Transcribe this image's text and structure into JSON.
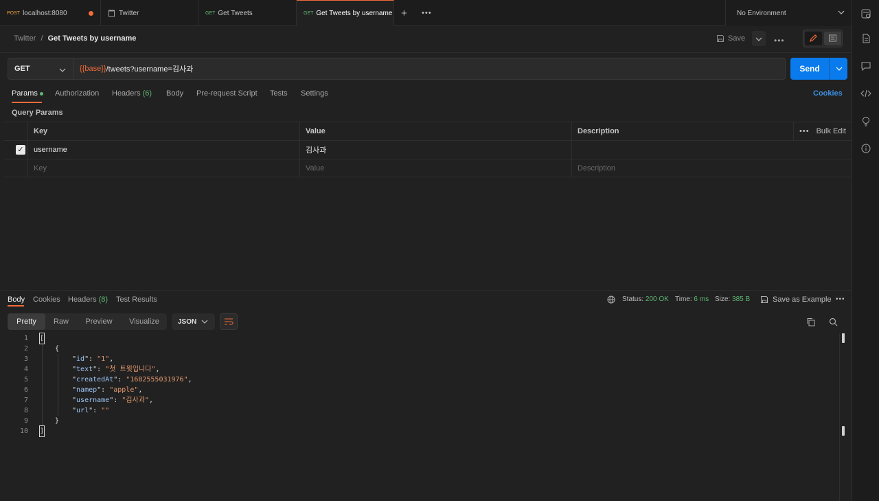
{
  "tabs": [
    {
      "method": "POST",
      "label": "localhost:8080",
      "unsaved": true
    },
    {
      "method": "",
      "label": "Twitter"
    },
    {
      "method": "GET",
      "label": "Get Tweets"
    },
    {
      "method": "GET",
      "label": "Get Tweets by username",
      "active": true
    }
  ],
  "environment": "No Environment",
  "breadcrumb": {
    "parent": "Twitter",
    "sep": "/",
    "current": "Get Tweets by username"
  },
  "toolbar": {
    "save_label": "Save"
  },
  "request": {
    "method": "GET",
    "url_var": "{{base}}",
    "url_rest": "/tweets?username=김사과",
    "send_label": "Send"
  },
  "request_tabs": {
    "params": "Params",
    "authorization": "Authorization",
    "headers": "Headers",
    "headers_count": "(6)",
    "body": "Body",
    "prerequest": "Pre-request Script",
    "tests": "Tests",
    "settings": "Settings",
    "cookies": "Cookies"
  },
  "query_params": {
    "title": "Query Params",
    "headers": {
      "key": "Key",
      "value": "Value",
      "description": "Description",
      "bulk": "Bulk Edit"
    },
    "rows": [
      {
        "key": "username",
        "value": "김사과",
        "description": "",
        "checked": true
      }
    ],
    "placeholder": {
      "key": "Key",
      "value": "Value",
      "description": "Description"
    }
  },
  "response_tabs": {
    "body": "Body",
    "cookies": "Cookies",
    "headers": "Headers",
    "headers_count": "(8)",
    "test_results": "Test Results"
  },
  "response_meta": {
    "status_label": "Status:",
    "status_value": "200 OK",
    "time_label": "Time:",
    "time_value": "6 ms",
    "size_label": "Size:",
    "size_value": "385 B",
    "save_example": "Save as Example"
  },
  "view_modes": [
    "Pretty",
    "Raw",
    "Preview",
    "Visualize"
  ],
  "format": "JSON",
  "code_lines": [
    {
      "n": "1",
      "text": "["
    },
    {
      "n": "2",
      "text": "{"
    },
    {
      "n": "3",
      "key": "id",
      "val": "1"
    },
    {
      "n": "4",
      "key": "text",
      "val": "첫 트윗입니다"
    },
    {
      "n": "5",
      "key": "createdAt",
      "val": "1682555031976"
    },
    {
      "n": "6",
      "key": "namep",
      "val": "apple"
    },
    {
      "n": "7",
      "key": "username",
      "val": "김사과"
    },
    {
      "n": "8",
      "key": "url",
      "val": ""
    },
    {
      "n": "9",
      "text": "}"
    },
    {
      "n": "10",
      "text": "]"
    }
  ]
}
